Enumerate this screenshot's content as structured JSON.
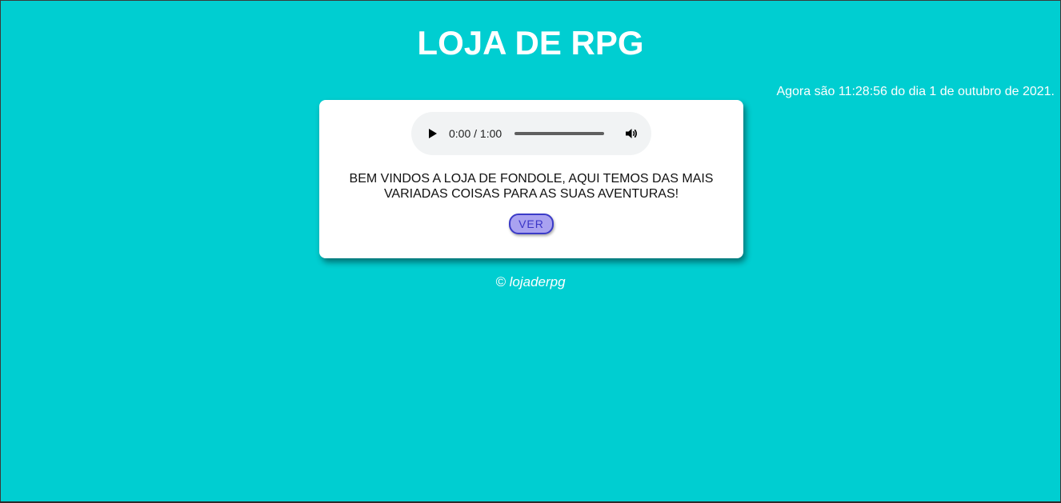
{
  "header": {
    "title": "LOJA DE RPG"
  },
  "clock": {
    "text": "Agora são 11:28:56 do dia 1 de outubro de 2021."
  },
  "audio_player": {
    "time": "0:00 / 1:00",
    "play_icon": "play-icon",
    "volume_icon": "volume-icon"
  },
  "card": {
    "welcome_line1": "BEM VINDOS A LOJA DE FONDOLE, AQUI TEMOS DAS MAIS",
    "welcome_line2": "VARIADAS COISAS PARA AS SUAS AVENTURAS!",
    "button_label": "VER"
  },
  "footer": {
    "text": "© lojaderpg"
  },
  "colors": {
    "background": "#00ced1",
    "card": "#ffffff",
    "button_fill": "#a9a2f0",
    "button_border": "#3b3bc8"
  }
}
